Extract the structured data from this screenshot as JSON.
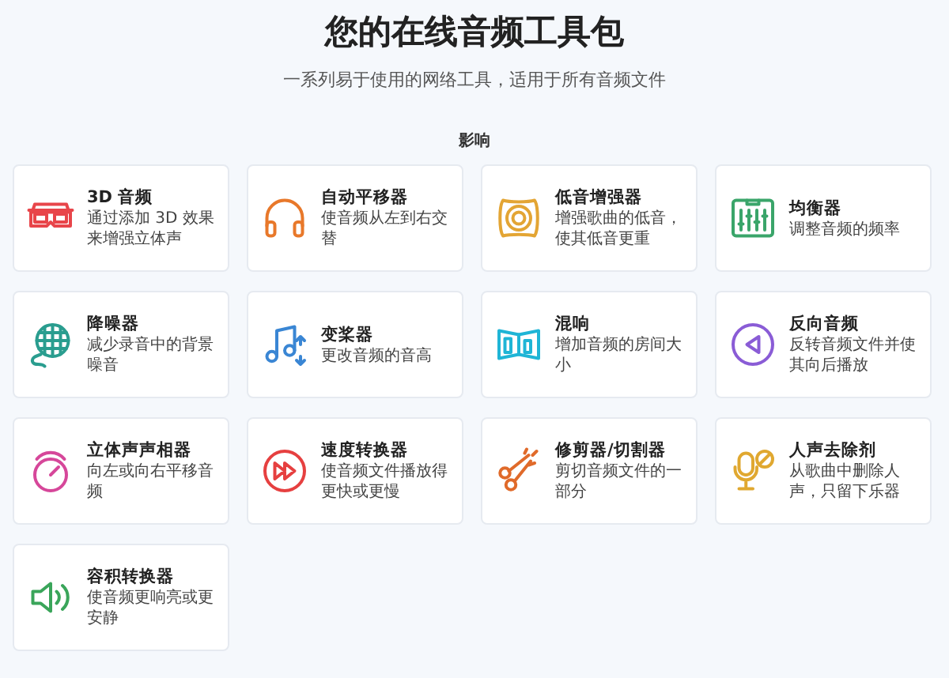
{
  "title": "您的在线音频工具包",
  "subtitle": "一系列易于使用的网络工具，适用于所有音频文件",
  "section": {
    "heading": "影响",
    "tools": [
      {
        "name": "3D 音频",
        "description": "通过添加 3D 效果来增强立体声"
      },
      {
        "name": "自动平移器",
        "description": "使音频从左到右交替"
      },
      {
        "name": "低音增强器",
        "description": "增强歌曲的低音，使其低音更重"
      },
      {
        "name": "均衡器",
        "description": "调整音频的频率"
      },
      {
        "name": "降噪器",
        "description": "减少录音中的背景噪音"
      },
      {
        "name": "变桨器",
        "description": "更改音频的音高"
      },
      {
        "name": "混响",
        "description": "增加音频的房间大小"
      },
      {
        "name": "反向音频",
        "description": "反转音频文件并使其向后播放"
      },
      {
        "name": "立体声声相器",
        "description": "向左或向右平移音频"
      },
      {
        "name": "速度转换器",
        "description": "使音频文件播放得更快或更慢"
      },
      {
        "name": "修剪器/切割器",
        "description": "剪切音频文件的一部分"
      },
      {
        "name": "人声去除剂",
        "description": "从歌曲中删除人声，只留下乐器"
      },
      {
        "name": "容积转换器",
        "description": "使音频更响亮或更安静"
      }
    ]
  }
}
